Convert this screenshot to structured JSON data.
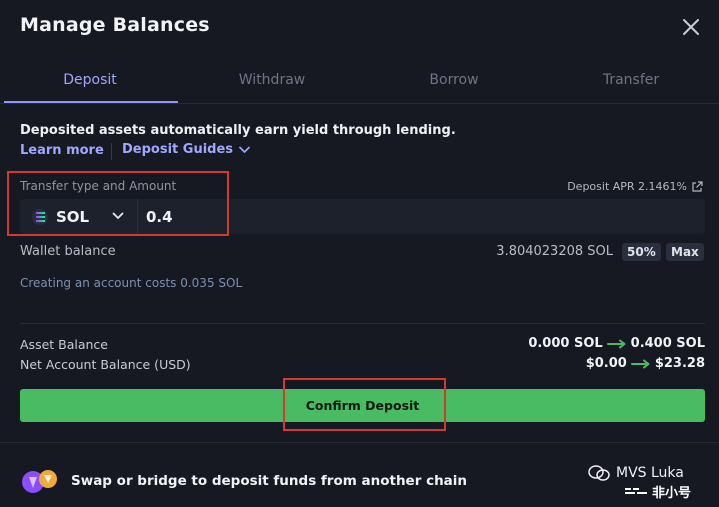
{
  "modal": {
    "title": "Manage Balances"
  },
  "tabs": [
    {
      "label": "Deposit",
      "active": true
    },
    {
      "label": "Withdraw",
      "active": false
    },
    {
      "label": "Borrow",
      "active": false
    },
    {
      "label": "Transfer",
      "active": false
    }
  ],
  "intro": {
    "text": "Deposited assets automatically earn yield through lending.",
    "learn_more": "Learn more",
    "guides": "Deposit Guides"
  },
  "form": {
    "amount_label": "Transfer type and Amount",
    "apr": "Deposit APR 2.1461%",
    "token": "SOL",
    "amount": "0.4"
  },
  "wallet": {
    "label": "Wallet balance",
    "value": "3.804023208 SOL",
    "half": "50%",
    "max": "Max"
  },
  "account_cost": "Creating an account costs 0.035 SOL",
  "balances": {
    "asset_label": "Asset Balance",
    "asset_from": "0.000 SOL",
    "asset_to": "0.400 SOL",
    "net_label": "Net Account Balance (USD)",
    "net_from": "$0.00",
    "net_to": "$23.28"
  },
  "confirm_label": "Confirm Deposit",
  "bridge_text": "Swap or bridge to deposit funds from another chain",
  "watermark": {
    "line1": "MVS Luka",
    "line2": "非小号"
  },
  "colors": {
    "accent": "#9fa7ff",
    "confirm": "#49bb62",
    "arrow": "#49bb62",
    "highlight": "#d23a2f"
  }
}
